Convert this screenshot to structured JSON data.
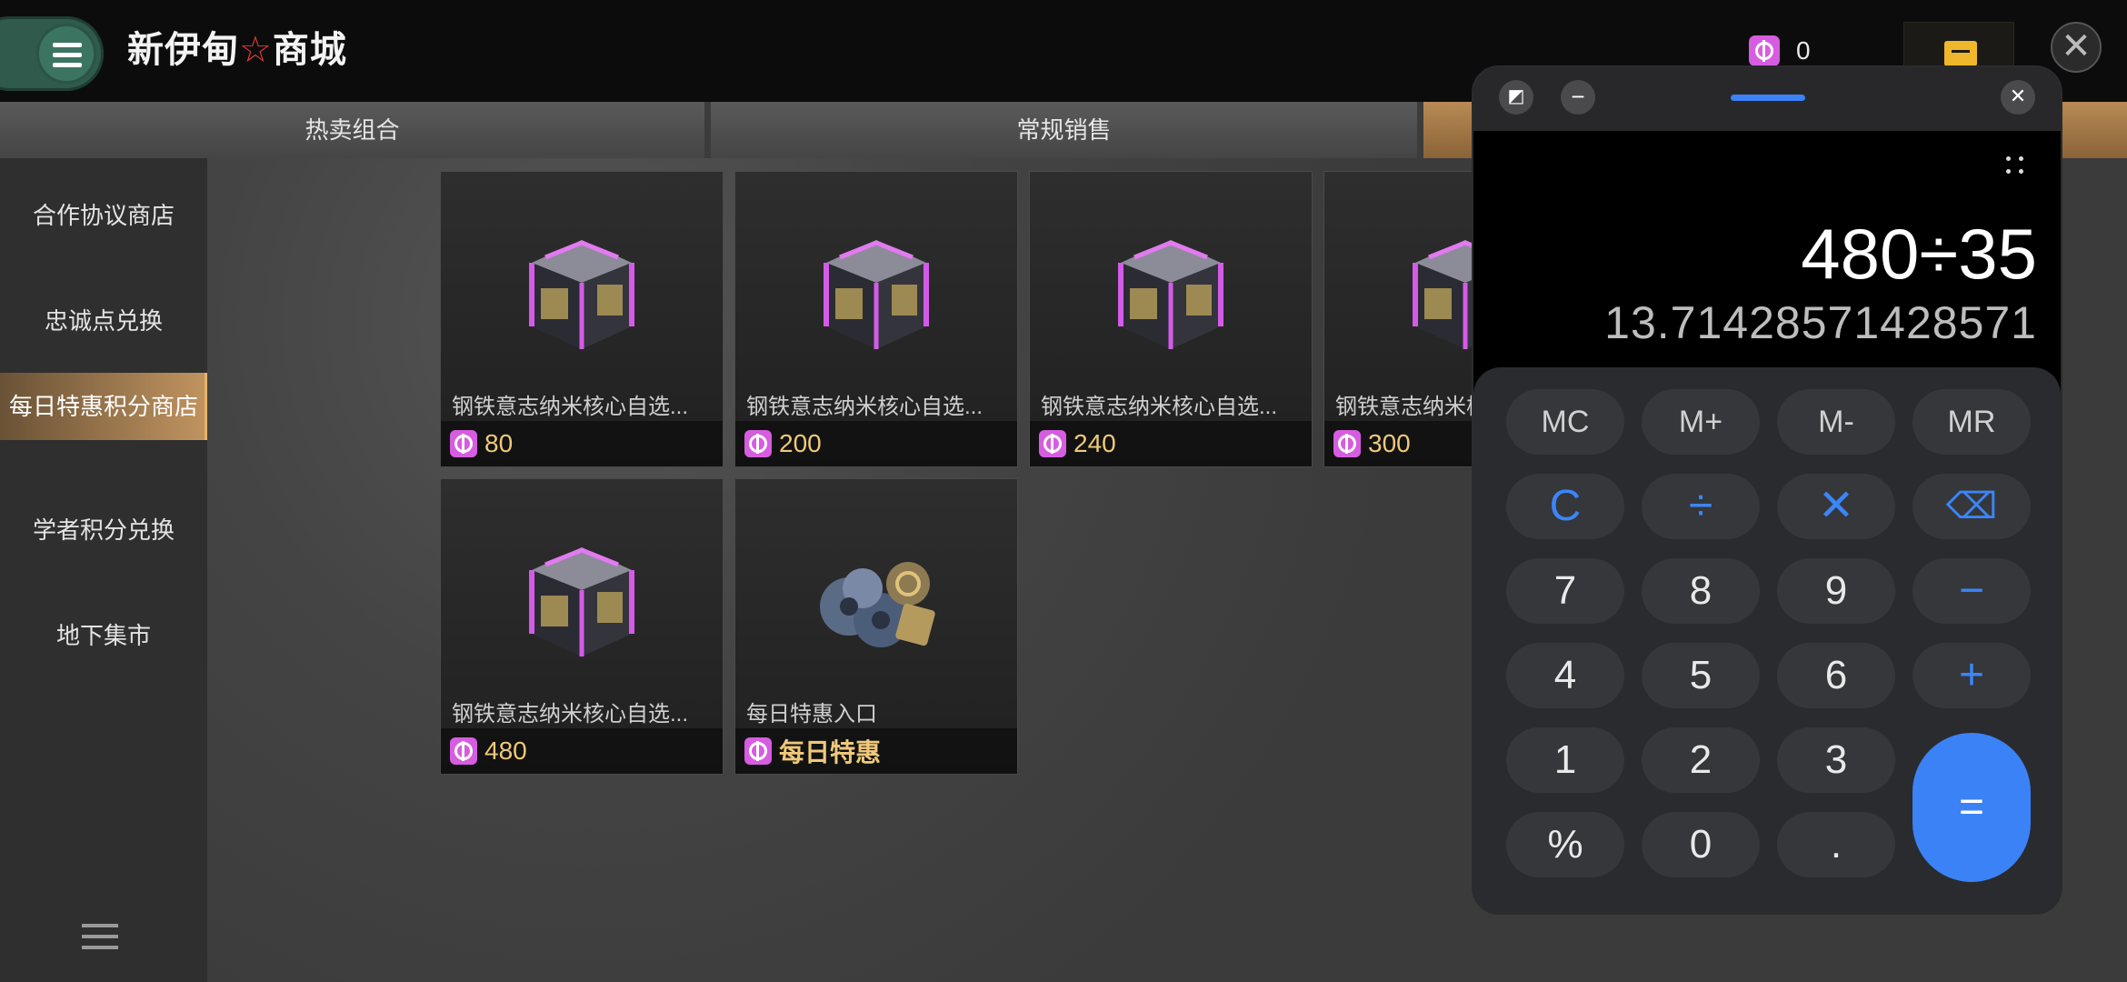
{
  "app": {
    "title_left": "新伊甸",
    "title_star": "☆",
    "title_right": "商城",
    "currency_value": "0"
  },
  "tabs": [
    "热卖组合",
    "常规销售"
  ],
  "sidebar": {
    "items": [
      "合作协议商店",
      "忠诚点兑换",
      "每日特惠积分商店",
      "学者积分兑换",
      "地下集市"
    ],
    "active_index": 2
  },
  "products": [
    {
      "name": "钢铁意志纳米核心自选...",
      "price": "80"
    },
    {
      "name": "钢铁意志纳米核心自选...",
      "price": "200"
    },
    {
      "name": "钢铁意志纳米核心自选...",
      "price": "240"
    },
    {
      "name": "钢铁意志纳米核心自选...",
      "price": "300"
    },
    {
      "name": "钢铁意志纳米核心自选...",
      "price": "480"
    },
    {
      "name": "每日特惠入口",
      "price": "每日特惠"
    }
  ],
  "calculator": {
    "expression": "480÷35",
    "result": "13.71428571428571",
    "keys": {
      "mc": "MC",
      "mplus": "M+",
      "mminus": "M-",
      "mr": "MR",
      "clear": "C",
      "divide": "÷",
      "multiply": "✕",
      "backspace": "⌫",
      "seven": "7",
      "eight": "8",
      "nine": "9",
      "minus": "−",
      "four": "4",
      "five": "5",
      "six": "6",
      "plus": "+",
      "one": "1",
      "two": "2",
      "three": "3",
      "equals": "=",
      "percent": "%",
      "zero": "0",
      "dot": "."
    }
  },
  "colors": {
    "accent": "#3b82f6",
    "coin": "#d65de0",
    "price": "#efc97a",
    "active_tab": "#c19460"
  }
}
